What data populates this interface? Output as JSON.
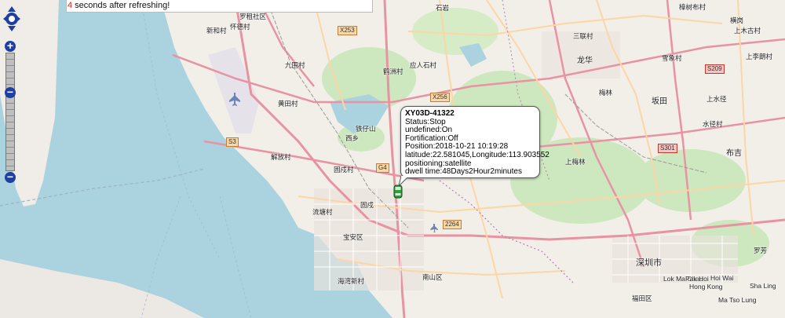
{
  "refresh": {
    "count": "4",
    "text": " seconds after refreshing!"
  },
  "controls": {
    "pan_icon": "pan-arrows-icon",
    "zoom_in": "+",
    "zoom_out": "−",
    "zoom_mid": "−"
  },
  "popup": {
    "title": "XY03D-41322",
    "lines": [
      "Status:Stop",
      "undefined:On",
      "Fortification:Off",
      "Position:2018-10-21 10:19:28",
      "latitude:22.581045,Longitude:113.903552",
      "positioning:satellite",
      "dwell time:48Days2Hour2minutes"
    ]
  },
  "vehicle_icon": "car-icon",
  "map_labels": [
    "石岩",
    "罗租社区",
    "新和村",
    "怀德村",
    "九围村",
    "黄田村",
    "应人石村",
    "鹤洲村",
    "铁仔山",
    "西乡",
    "解放村",
    "固戍村",
    "固戍",
    "流塘村",
    "宝安区",
    "南山区",
    "深圳市",
    "福田区",
    "坂田",
    "龙华",
    "布吉",
    "水径村",
    "梅林",
    "上水径",
    "上梅林",
    "横岗",
    "三联村",
    "雪象村",
    "上李朗村",
    "上木古村",
    "樟树布村",
    "罗芳",
    "Hong Kong",
    "Ma Tso Lung",
    "Sha Ling",
    "Lok Ma Chau",
    "Pak Hoi",
    "Hoi Wai",
    "海湾新村"
  ],
  "road_shields": [
    "X253",
    "S3",
    "G4",
    "X256",
    "S209",
    "S301",
    "2264"
  ]
}
